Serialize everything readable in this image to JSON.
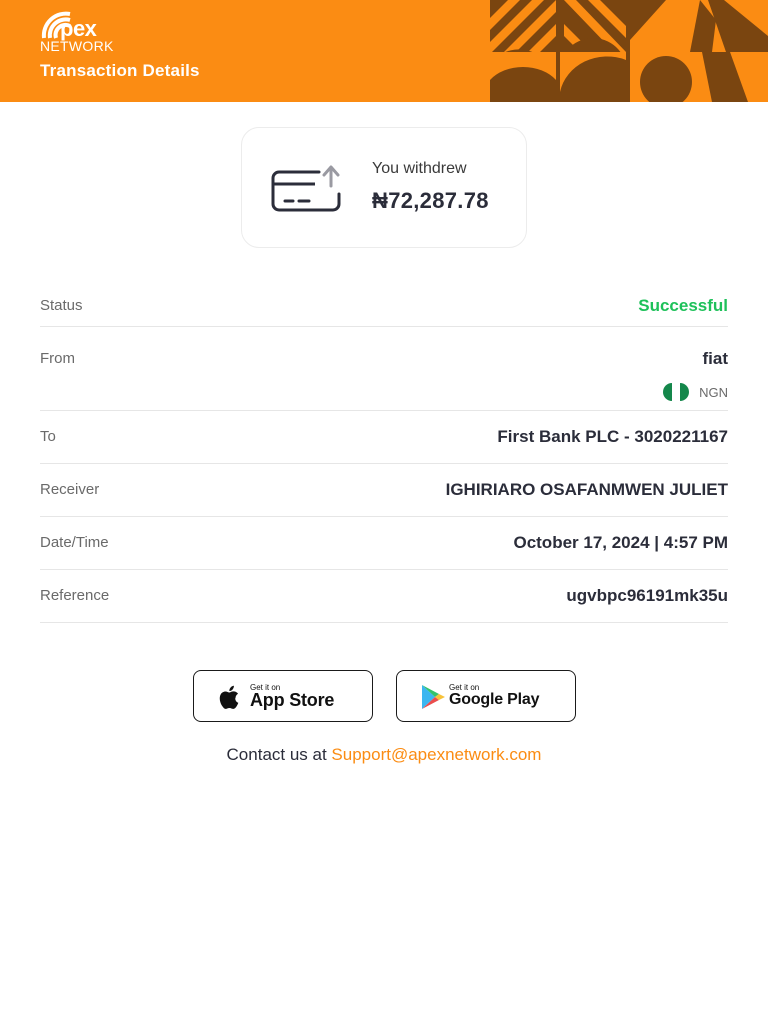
{
  "header": {
    "logo_word": "pex",
    "logo_sub": "NETWORK",
    "title": "Transaction Details",
    "brand_color": "#fb8c13",
    "art_color": "#7a4510"
  },
  "summary": {
    "label": "You withdrew",
    "amount": "₦72,287.78",
    "icon": "card-withdraw-icon"
  },
  "details": {
    "status": {
      "label": "Status",
      "value": "Successful",
      "color": "#1ec15a"
    },
    "from": {
      "label": "From",
      "value": "fiat",
      "currency": "NGN",
      "flag": "nigeria-flag-icon"
    },
    "to": {
      "label": "To",
      "value": "First Bank PLC - 3020221167"
    },
    "receiver": {
      "label": "Receiver",
      "value": "IGHIRIARO OSAFANMWEN JULIET"
    },
    "datetime": {
      "label": "Date/Time",
      "value": "October 17, 2024 | 4:57 PM"
    },
    "reference": {
      "label": "Reference",
      "value": "ugvbpc96191mk35u"
    }
  },
  "stores": {
    "appstore": {
      "small": "Get it on",
      "big": "App Store",
      "icon": "apple-icon"
    },
    "google": {
      "small": "Get it on",
      "big": "Google Play",
      "icon": "google-play-icon"
    }
  },
  "contact": {
    "prefix": "Contact us at ",
    "email": "Support@apexnetwork.com"
  }
}
